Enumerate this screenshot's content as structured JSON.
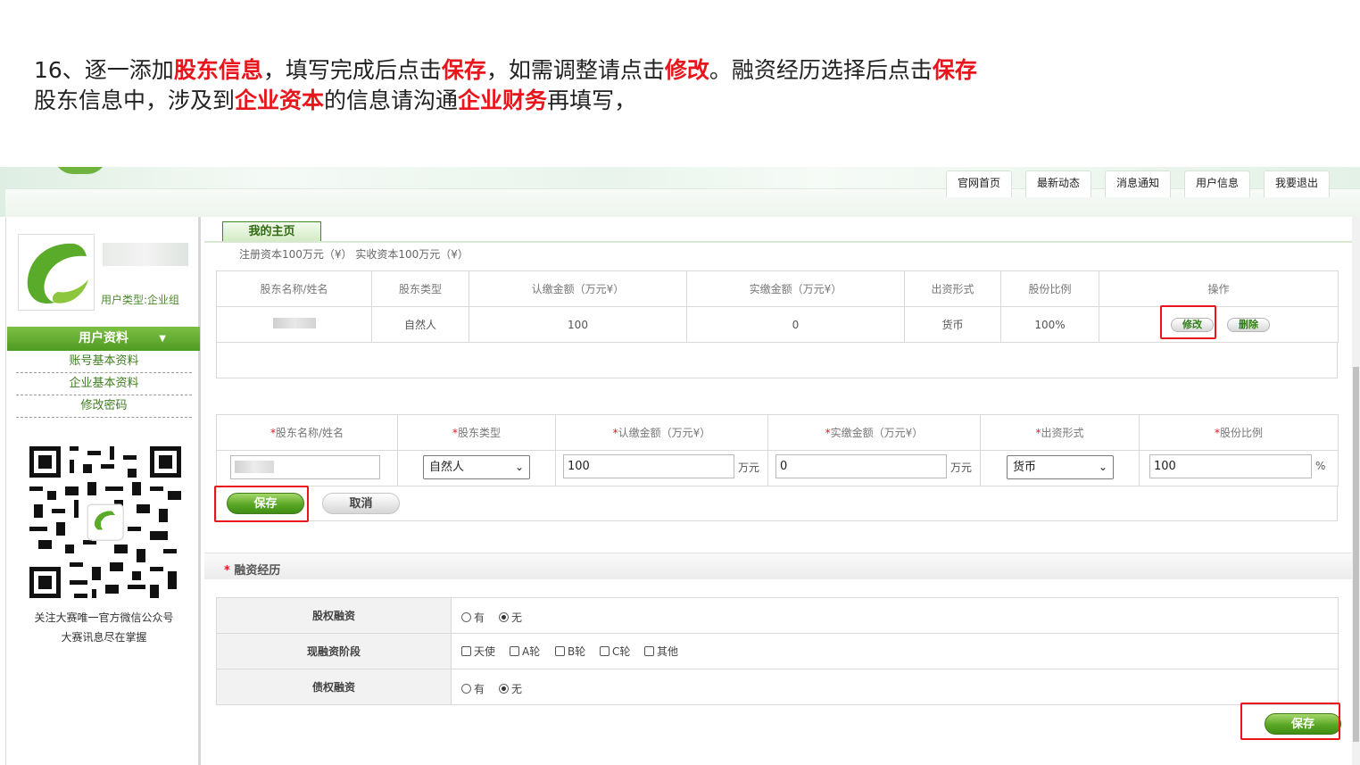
{
  "instruction": {
    "line1": [
      {
        "text": "16、逐一添加",
        "hl": false
      },
      {
        "text": "股东信息",
        "hl": true
      },
      {
        "text": "，填写完成后点击",
        "hl": false
      },
      {
        "text": "保存",
        "hl": true
      },
      {
        "text": "，如需调整请点击",
        "hl": false
      },
      {
        "text": "修改",
        "hl": true
      },
      {
        "text": "。融资经历选择后点击",
        "hl": false
      },
      {
        "text": "保存",
        "hl": true
      }
    ],
    "line2": [
      {
        "text": "股东信息中，涉及到",
        "hl": false
      },
      {
        "text": "企业资本",
        "hl": true
      },
      {
        "text": "的信息请沟通",
        "hl": false
      },
      {
        "text": "企业财务",
        "hl": true
      },
      {
        "text": "再填写，",
        "hl": false
      }
    ],
    "highlight_color": "#e8161c"
  },
  "nav": {
    "tabs": [
      "官网首页",
      "最新动态",
      "消息通知",
      "用户信息",
      "我要退出"
    ]
  },
  "sidebar": {
    "user_type": "用户类型:企业组",
    "section_title": "用户资料",
    "links": [
      "账号基本资料",
      "企业基本资料",
      "修改密码"
    ],
    "qr_caption_1": "关注大赛唯一官方微信公众号",
    "qr_caption_2": "大赛讯息尽在掌握"
  },
  "main": {
    "home_tab": "我的主页",
    "capital_info": "注册资本100万元（¥）    实收资本100万元（¥）",
    "list_headers": [
      "股东名称/姓名",
      "股东类型",
      "认缴金额（万元¥）",
      "实缴金额（万元¥）",
      "出资形式",
      "股份比例",
      "操作"
    ],
    "list_row": {
      "type": "自然人",
      "subscribed": "100",
      "paid": "0",
      "form": "货币",
      "ratio": "100%",
      "edit_label": "修改",
      "delete_label": "删除"
    },
    "form_headers": [
      "股东名称/姓名",
      "股东类型",
      "认缴金额（万元¥）",
      "实缴金额（万元¥）",
      "出资形式",
      "股份比例"
    ],
    "form": {
      "type_value": "自然人",
      "subscribed_value": "100",
      "subscribed_unit": "万元",
      "paid_value": "0",
      "paid_unit": "万元",
      "form_value": "货币",
      "ratio_value": "100",
      "ratio_unit": "%",
      "save_label": "保存",
      "cancel_label": "取消"
    },
    "financing": {
      "title": "融资经历",
      "rows": [
        {
          "label": "股权融资",
          "options": [
            "有",
            "无"
          ],
          "selected": "无"
        },
        {
          "label": "现融资阶段",
          "options": [
            "天使",
            "A轮",
            "B轮",
            "C轮",
            "其他"
          ]
        },
        {
          "label": "债权融资",
          "options": [
            "有",
            "无"
          ],
          "selected": "无"
        }
      ],
      "save_label": "保存"
    }
  },
  "colors": {
    "accent_green": "#4f9b22",
    "highlight_red": "#e8161c"
  }
}
